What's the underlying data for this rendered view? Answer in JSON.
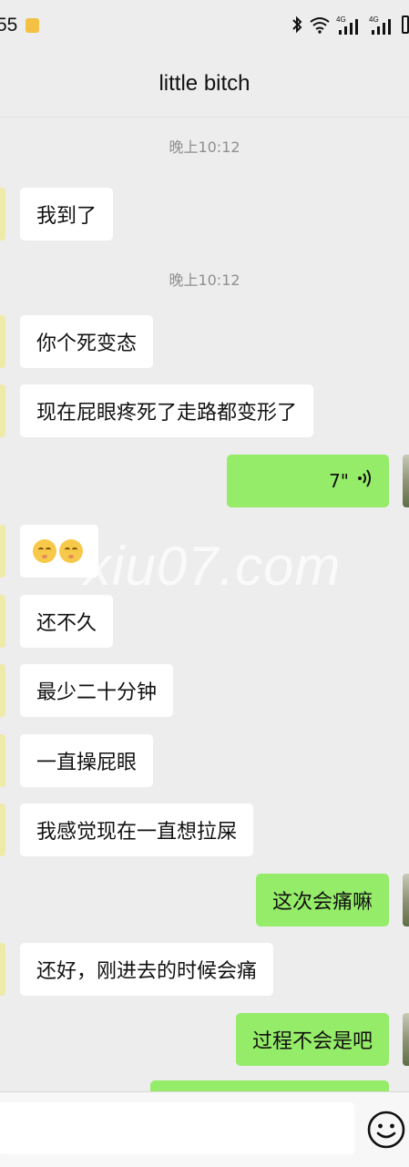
{
  "status_bar": {
    "time": "55",
    "icons": [
      "bluetooth-icon",
      "wifi-icon",
      "signal-4g-1-icon",
      "signal-4g-2-icon",
      "battery-icon"
    ]
  },
  "header": {
    "title": "little bitch"
  },
  "messages": [
    {
      "type": "timestamp",
      "text": "晚上10:12"
    },
    {
      "type": "text",
      "side": "left",
      "text": "我到了"
    },
    {
      "type": "timestamp",
      "text": "晚上10:12"
    },
    {
      "type": "text",
      "side": "left",
      "text": "你个死变态"
    },
    {
      "type": "text",
      "side": "left",
      "text": "现在屁眼疼死了走路都变形了"
    },
    {
      "type": "voice",
      "side": "right",
      "text": "7\""
    },
    {
      "type": "emoji",
      "side": "left",
      "emoji_count": 2,
      "emoji_name": "face-with-closed-eyes"
    },
    {
      "type": "text",
      "side": "left",
      "text": "还不久"
    },
    {
      "type": "text",
      "side": "left",
      "text": "最少二十分钟"
    },
    {
      "type": "text",
      "side": "left",
      "text": "一直操屁眼"
    },
    {
      "type": "text",
      "side": "left",
      "text": "我感觉现在一直想拉屎"
    },
    {
      "type": "text",
      "side": "right",
      "text": "这次会痛嘛"
    },
    {
      "type": "text",
      "side": "left",
      "text": "还好，刚进去的时候会痛"
    },
    {
      "type": "text",
      "side": "right",
      "text": "过程不会是吧"
    }
  ],
  "watermark": "xiu07.com",
  "input_bar": {
    "placeholder": "",
    "emoji_icon": "emoji-icon"
  },
  "colors": {
    "background": "#ededed",
    "bubble_left": "#ffffff",
    "bubble_right": "#95ec69",
    "timestamp": "#8f8f8f"
  }
}
